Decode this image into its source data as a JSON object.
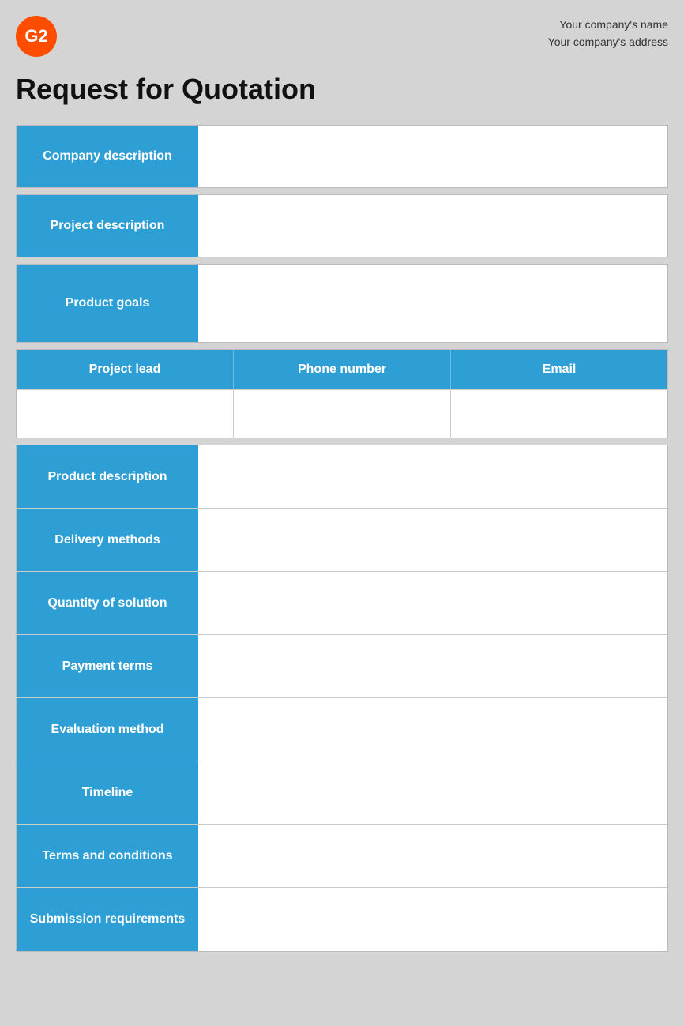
{
  "header": {
    "company_name": "Your company's name",
    "company_address": "Your company's address"
  },
  "logo": {
    "text": "G2"
  },
  "title": "Request for Quotation",
  "form": {
    "sections_top": [
      {
        "id": "company-description",
        "label": "Company description"
      },
      {
        "id": "project-description",
        "label": "Project description"
      },
      {
        "id": "product-goals",
        "label": "Product goals"
      }
    ],
    "contact": {
      "columns": [
        {
          "id": "project-lead",
          "label": "Project lead"
        },
        {
          "id": "phone-number",
          "label": "Phone number"
        },
        {
          "id": "email",
          "label": "Email"
        }
      ]
    },
    "sections_bottom": [
      {
        "id": "product-description",
        "label": "Product description"
      },
      {
        "id": "delivery-methods",
        "label": "Delivery methods"
      },
      {
        "id": "quantity-of-solution",
        "label": "Quantity of solution"
      },
      {
        "id": "payment-terms",
        "label": "Payment terms"
      },
      {
        "id": "evaluation-method",
        "label": "Evaluation method"
      },
      {
        "id": "timeline",
        "label": "Timeline"
      },
      {
        "id": "terms-and-conditions",
        "label": "Terms and conditions"
      },
      {
        "id": "submission-requirements",
        "label": "Submission requirements"
      }
    ]
  },
  "colors": {
    "blue": "#2e9fd4",
    "orange": "#ff4d00",
    "bg": "#d4d4d4",
    "border": "#bbbbbb",
    "white": "#ffffff"
  }
}
